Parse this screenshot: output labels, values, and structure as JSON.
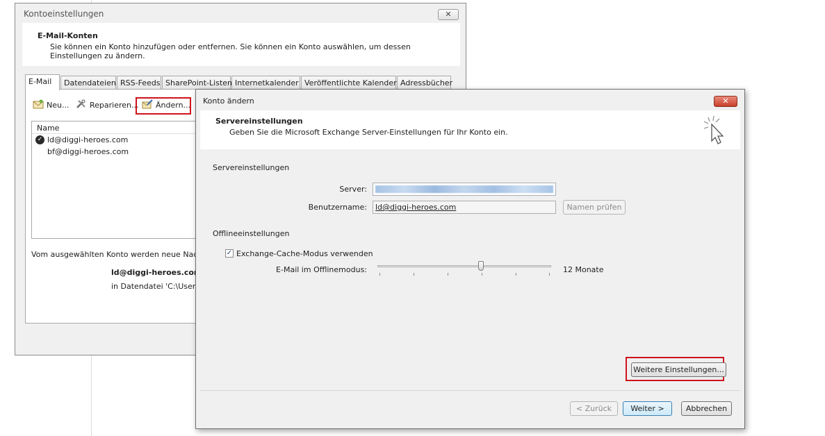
{
  "back_window": {
    "title": "Kontoeinstellungen",
    "close_label": "✕",
    "header_title": "E-Mail-Konten",
    "header_desc": "Sie können ein Konto hinzufügen oder entfernen. Sie können ein Konto auswählen, um dessen Einstellungen zu ändern.",
    "tabs": [
      "E-Mail",
      "Datendateien",
      "RSS-Feeds",
      "SharePoint-Listen",
      "Internetkalender",
      "Veröffentlichte Kalender",
      "Adressbücher"
    ],
    "toolbar": {
      "new_label": "Neu...",
      "repair_label": "Reparieren...",
      "change_label": "Ändern..."
    },
    "list_header": "Name",
    "accounts": [
      "ld@diggi-heroes.com",
      "bf@diggi-heroes.com"
    ],
    "info_text": "Vom ausgewählten Konto werden neue Nachr",
    "info_account": "ld@diggi-heroes.com\\P",
    "info_path": "in Datendatei 'C:\\Users\\"
  },
  "front_window": {
    "title": "Konto ändern",
    "close_label": "✕",
    "header_title": "Servereinstellungen",
    "header_desc": "Geben Sie die Microsoft Exchange Server-Einstellungen für Ihr Konto ein.",
    "server_section": "Servereinstellungen",
    "server_label": "Server:",
    "username_label": "Benutzername:",
    "username_value": "ld@diggi-heroes.com",
    "check_names_label": "Namen prüfen",
    "offline_section": "Offlineeinstellungen",
    "cache_mode_label": "Exchange-Cache-Modus verwenden",
    "cache_mode_checked": true,
    "offline_mail_label": "E-Mail im Offlinemodus:",
    "offline_months_label": "12 Monate",
    "slider_level": 0.6,
    "more_settings_label": "Weitere Einstellungen...",
    "back_label": "< Zurück",
    "next_label": "Weiter >",
    "cancel_label": "Abbrechen"
  },
  "colors": {
    "highlight_red": "#d0121c",
    "accent_blue": "#3c7fb1"
  }
}
